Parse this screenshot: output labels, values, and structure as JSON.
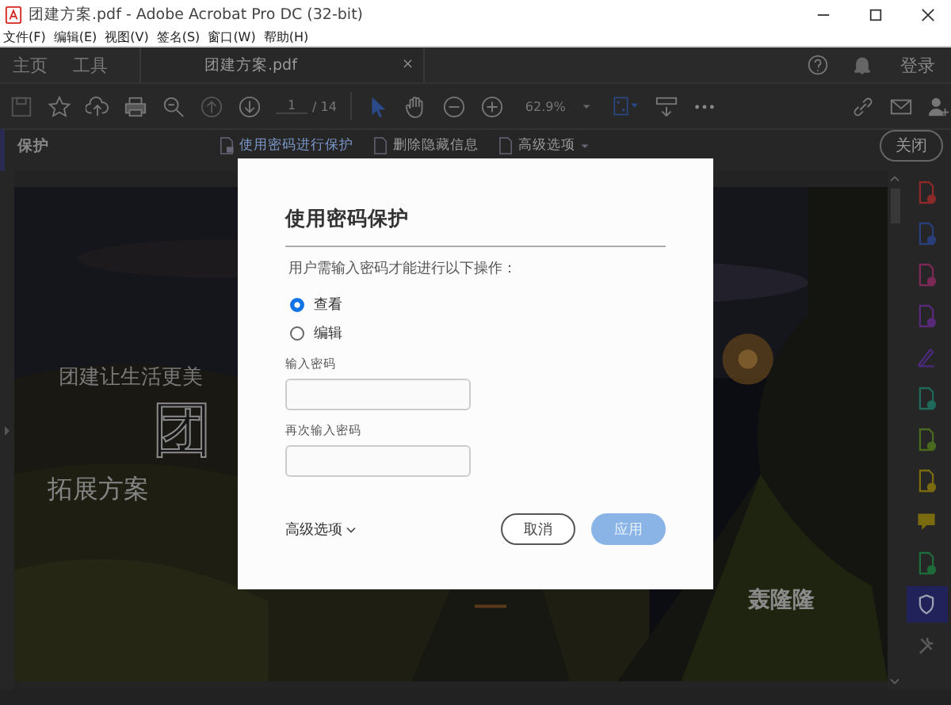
{
  "window": {
    "title": "团建方案.pdf - Adobe Acrobat Pro DC (32-bit)"
  },
  "menu": [
    "文件(F)",
    "编辑(E)",
    "视图(V)",
    "签名(S)",
    "窗口(W)",
    "帮助(H)"
  ],
  "tabs": [
    {
      "label": "主页",
      "selected": false
    },
    {
      "label": "工具",
      "selected": false
    },
    {
      "label": "团建方案.pdf",
      "selected": true,
      "close": "×"
    }
  ],
  "sign_in": "登录",
  "toolbar": {
    "page": "1",
    "pages": "/ 14",
    "zoom": "62.9%"
  },
  "protect_bar": {
    "title": "保护",
    "actions": [
      "使用密码进行保护",
      "删除隐藏信息",
      "高级选项"
    ],
    "close": "关闭"
  },
  "document": {
    "texts": [
      {
        "kind": "subtitle",
        "text": "团建让生活更美"
      },
      {
        "kind": "outline",
        "text": "团"
      },
      {
        "kind": "heading",
        "text": "拓展方案"
      },
      {
        "kind": "signature",
        "text": "轰隆隆"
      }
    ]
  },
  "right_tools": [
    {
      "kind": "document",
      "color": "#8a2a2a",
      "selected": false
    },
    {
      "kind": "document",
      "color": "#2a3f7a",
      "selected": false
    },
    {
      "kind": "document",
      "color": "#7a2a55",
      "selected": false
    },
    {
      "kind": "document",
      "color": "#5a2a7a",
      "selected": false
    },
    {
      "kind": "pen",
      "color": "#4a2a7a",
      "selected": false
    },
    {
      "kind": "document",
      "color": "#1f6a5a",
      "selected": false
    },
    {
      "kind": "document",
      "color": "#4a6a1f",
      "selected": false
    },
    {
      "kind": "document",
      "color": "#7a6a10",
      "selected": false
    },
    {
      "kind": "comment",
      "color": "#7a6a10",
      "selected": false
    },
    {
      "kind": "document",
      "color": "#1f6a3a",
      "selected": false
    },
    {
      "kind": "shield",
      "color": "#9aa0b0",
      "selected": true
    },
    {
      "kind": "tools",
      "color": "#5a5a5a",
      "selected": false
    }
  ],
  "dialog": {
    "title": "使用密码保护",
    "description": "用户需输入密码才能进行以下操作：",
    "options": [
      {
        "label": "查看",
        "selected": true
      },
      {
        "label": "编辑",
        "selected": false
      }
    ],
    "fields": [
      {
        "label": "输入密码"
      },
      {
        "label": "再次输入密码"
      }
    ],
    "advanced": "高级选项",
    "cancel": "取消",
    "apply": {
      "label": "应用",
      "disabled": true
    }
  }
}
